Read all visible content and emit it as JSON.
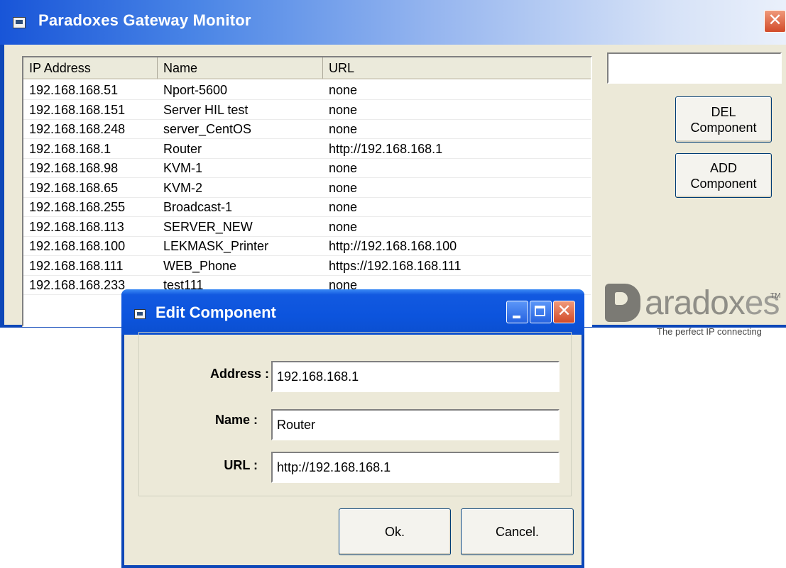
{
  "main_window": {
    "title": "Paradoxes Gateway Monitor",
    "close_glyph": "✕",
    "search_value": ""
  },
  "list": {
    "columns": [
      "IP Address",
      "Name",
      "URL"
    ],
    "rows": [
      {
        "ip": "192.168.168.51",
        "name": "Nport-5600",
        "url": "none"
      },
      {
        "ip": "192.168.168.151",
        "name": "Server HIL test",
        "url": "none"
      },
      {
        "ip": "192.168.168.248",
        "name": "server_CentOS",
        "url": "none"
      },
      {
        "ip": "192.168.168.1",
        "name": "Router",
        "url": "http://192.168.168.1"
      },
      {
        "ip": "192.168.168.98",
        "name": "KVM-1",
        "url": "none"
      },
      {
        "ip": "192.168.168.65",
        "name": "KVM-2",
        "url": "none"
      },
      {
        "ip": "192.168.168.255",
        "name": "Broadcast-1",
        "url": "none"
      },
      {
        "ip": "192.168.168.113",
        "name": "SERVER_NEW",
        "url": "none"
      },
      {
        "ip": "192.168.168.100",
        "name": "LEKMASK_Printer",
        "url": "http://192.168.168.100"
      },
      {
        "ip": "192.168.168.111",
        "name": "WEB_Phone",
        "url": "https://192.168.168.111"
      },
      {
        "ip": "192.168.168.233",
        "name": "test111",
        "url": "none"
      }
    ]
  },
  "buttons": {
    "del_line1": "DEL",
    "del_line2": "Component",
    "add_line1": "ADD",
    "add_line2": "Component"
  },
  "logo": {
    "brand_main": "aradox",
    "brand_end": "es",
    "tm": "TM",
    "tagline": "The perfect IP connecting"
  },
  "dialog": {
    "title": "Edit Component",
    "close_glyph": "✕",
    "address_label": "Address :",
    "address_value": "192.168.168.1",
    "name_label": "Name :",
    "name_value": "Router",
    "url_label": "URL :",
    "url_value": "http://192.168.168.1",
    "ok_label": "Ok.",
    "cancel_label": "Cancel."
  },
  "colors": {
    "titlebar_blue": "#0c54dd",
    "window_face": "#ece9d8",
    "close_red": "#d24b2a"
  },
  "icons": [
    "window-app-icon",
    "close-icon",
    "minimize-icon",
    "maximize-icon",
    "paradoxes-logo"
  ]
}
